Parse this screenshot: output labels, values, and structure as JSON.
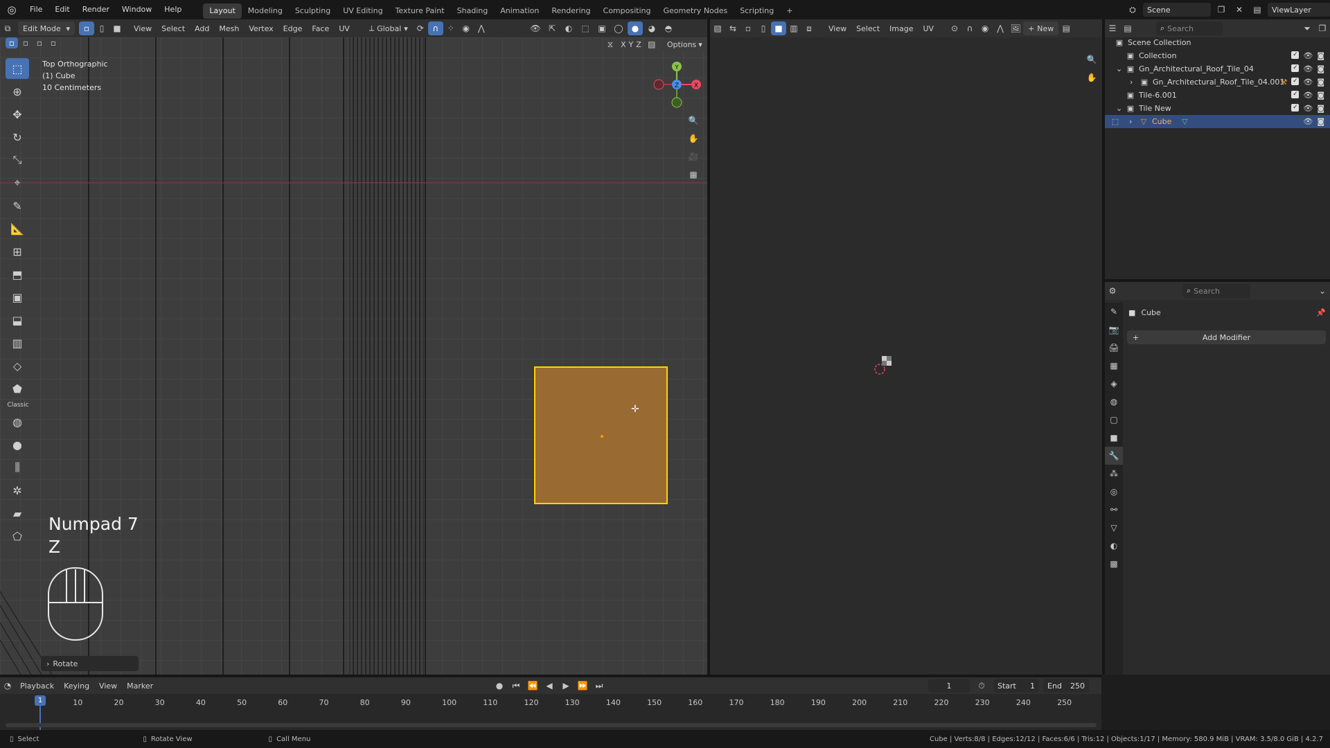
{
  "topbar": {
    "menus": [
      "File",
      "Edit",
      "Render",
      "Window",
      "Help"
    ],
    "workspaces": [
      "Layout",
      "Modeling",
      "Sculpting",
      "UV Editing",
      "Texture Paint",
      "Shading",
      "Animation",
      "Rendering",
      "Compositing",
      "Geometry Nodes",
      "Scripting"
    ],
    "active_workspace": "Layout",
    "add_tab": "+",
    "scene": "Scene",
    "view_layer": "ViewLayer"
  },
  "viewport3d": {
    "mode": "Edit Mode",
    "menus": [
      "View",
      "Select",
      "Add",
      "Mesh",
      "Vertex",
      "Edge",
      "Face",
      "UV"
    ],
    "orientation": "Global",
    "options_label": "Options",
    "axis_labels": [
      "X",
      "Y",
      "Z"
    ],
    "info": {
      "view": "Top Orthographic",
      "object": "(1) Cube",
      "scale": "10 Centimeters"
    },
    "keys_overlay": {
      "line1": "Numpad 7",
      "line2": "Z"
    },
    "last_op": "Rotate",
    "toolbar_classic": "Classic",
    "gizmo": {
      "x": "X",
      "y": "Y",
      "z": "Z"
    }
  },
  "uveditor": {
    "menus": [
      "View",
      "Select",
      "Image",
      "UV"
    ],
    "new_button": "New"
  },
  "outliner": {
    "search_placeholder": "Search",
    "rows": [
      {
        "label": "Scene Collection"
      },
      {
        "label": "Collection"
      },
      {
        "label": "Gn_Architectural_Roof_Tile_04"
      },
      {
        "label": "Gn_Architectural_Roof_Tile_04.001"
      },
      {
        "label": "Tile-6.001"
      },
      {
        "label": "Tile New"
      },
      {
        "label": "Cube"
      }
    ]
  },
  "properties": {
    "search_placeholder": "Search",
    "object_name": "Cube",
    "add_modifier": "Add Modifier"
  },
  "timeline": {
    "menus": [
      "Playback",
      "Keying",
      "View",
      "Marker"
    ],
    "current_frame": "1",
    "start_label": "Start",
    "start": "1",
    "end_label": "End",
    "end": "250",
    "ticks": [
      "1",
      "10",
      "20",
      "30",
      "40",
      "50",
      "60",
      "70",
      "80",
      "90",
      "100",
      "110",
      "120",
      "130",
      "140",
      "150",
      "160",
      "170",
      "180",
      "190",
      "200",
      "210",
      "220",
      "230",
      "240",
      "250"
    ]
  },
  "statusbar": {
    "select": "Select",
    "rotate_view": "Rotate View",
    "call_menu": "Call Menu",
    "stats": "Cube | Verts:8/8 | Edges:12/12 | Faces:6/6 | Tris:12 | Objects:1/17 | Memory: 580.9 MiB | VRAM: 3.5/8.0 GiB | 4.2.7"
  },
  "colors": {
    "accent": "#4772b3",
    "selected_face": "#9a6a33",
    "selected_edge": "#ffd400"
  }
}
